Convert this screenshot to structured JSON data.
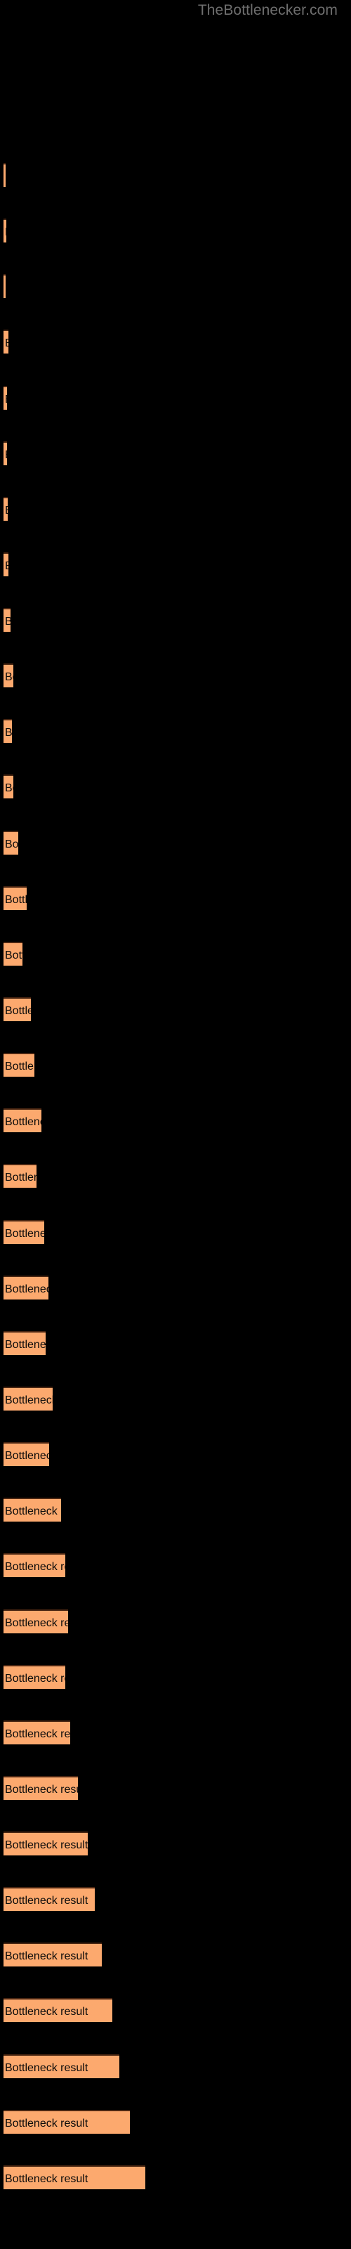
{
  "watermark": {
    "text": "TheBottlenecker.com",
    "color": "#6e6e6e"
  },
  "colors": {
    "background": "#000000",
    "bar_fill": "#fca96e",
    "bar_border_top": "#4a2612",
    "bar_label": "#0a0a0a"
  },
  "chart_data": {
    "type": "bar",
    "orientation": "horizontal",
    "title": "",
    "subtitle": "",
    "xlabel": "",
    "ylabel": "",
    "grid": false,
    "legend": null,
    "bar_label_text": "Bottleneck result",
    "xlim": [
      0,
      216
    ],
    "categories": [
      "Bottleneck result",
      "Bottleneck result",
      "Bottleneck result",
      "Bottleneck result",
      "Bottleneck result",
      "Bottleneck result",
      "Bottleneck result",
      "Bottleneck result",
      "Bottleneck result",
      "Bottleneck result",
      "Bottleneck result",
      "Bottleneck result",
      "Bottleneck result",
      "Bottleneck result",
      "Bottleneck result",
      "Bottleneck result",
      "Bottleneck result",
      "Bottleneck result",
      "Bottleneck result",
      "Bottleneck result",
      "Bottleneck result",
      "Bottleneck result",
      "Bottleneck result",
      "Bottleneck result",
      "Bottleneck result",
      "Bottleneck result",
      "Bottleneck result",
      "Bottleneck result",
      "Bottleneck result",
      "Bottleneck result",
      "Bottleneck result",
      "Bottleneck result",
      "Bottleneck result",
      "Bottleneck result",
      "Bottleneck result",
      "Bottleneck result",
      "Bottleneck result"
    ],
    "values": [
      3,
      4,
      3,
      7,
      5,
      5,
      6,
      7,
      10,
      14,
      12,
      14,
      21,
      33,
      27,
      39,
      44,
      54,
      47,
      58,
      64,
      60,
      70,
      65,
      82,
      88,
      92,
      88,
      95,
      106,
      120,
      130,
      140,
      155,
      165,
      180,
      202
    ],
    "bar_tops": [
      232,
      275,
      318,
      361,
      404,
      447,
      490,
      533,
      576,
      619,
      662,
      705,
      748,
      791,
      834,
      877,
      920,
      963,
      1006,
      1049,
      1092,
      1135,
      1178,
      1221,
      1264,
      1307,
      1350,
      1393,
      1436,
      1479,
      1522,
      1565,
      1608,
      1651,
      1694,
      1737,
      1780
    ]
  }
}
